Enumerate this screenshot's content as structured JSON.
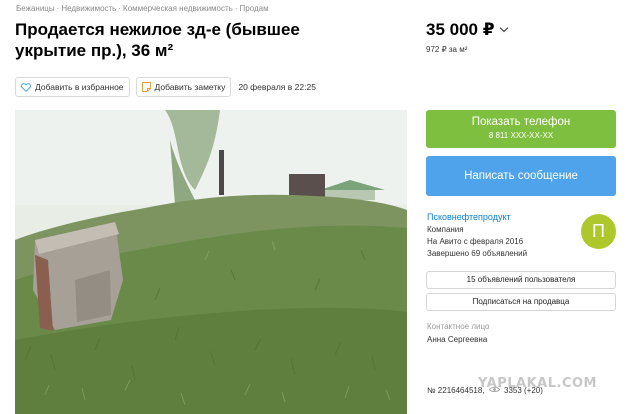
{
  "breadcrumbs": [
    "Бежаницы",
    "Недвижимость",
    "Коммерческая недвижимость",
    "Продам"
  ],
  "breadcrumb_separator": "·",
  "title": "Продается нежилое зд-е (бывшее укрытие пр.), 36 м²",
  "price": {
    "value": "35 000 ₽",
    "per_meter": "972 ₽ за м²"
  },
  "actions": {
    "favorite": "Добавить в избранное",
    "note": "Добавить заметку",
    "date": "20 февраля в 22:25"
  },
  "contact_buttons": {
    "phone_label": "Показать телефон",
    "phone_number": "8 811 XXX-XX-XX",
    "message": "Написать сообщение"
  },
  "seller": {
    "name": "Псковнефтепродукт",
    "type": "Компания",
    "since": "На Авито с февраля 2016",
    "completed": "Завершено 69 объявлений",
    "avatar_letter": "П",
    "ads_button": "15 объявлений пользователя",
    "subscribe_button": "Подписаться на продавца"
  },
  "contact": {
    "label": "Контактное лицо",
    "name": "Анна Сергеевна"
  },
  "ad_number": "№ 2216464518,",
  "ad_views": "3353 (+20)",
  "watermark": "YAPLAKAL.COM",
  "colors": {
    "phone_button": "#7fbf3f",
    "message_button": "#4ea3ea",
    "seller_link": "#0a7fd9",
    "avatar": "#aec82c"
  }
}
